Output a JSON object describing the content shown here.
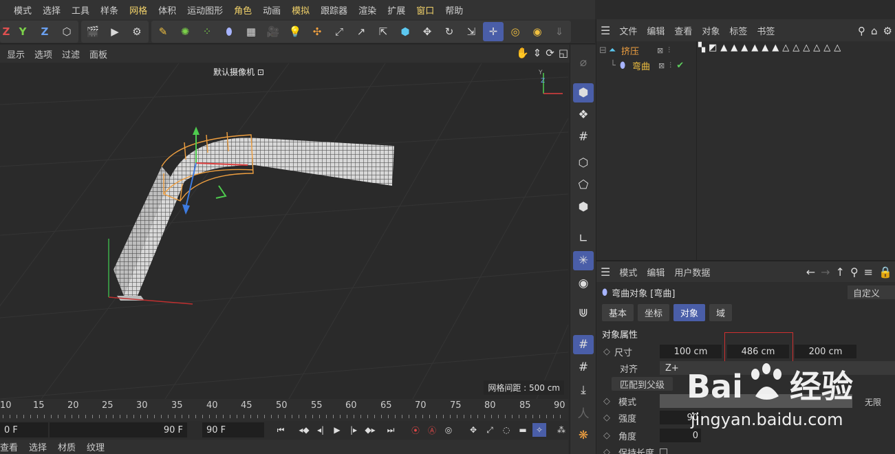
{
  "menu": [
    "模式",
    "选择",
    "工具",
    "样条",
    "网格",
    "体积",
    "运动图形",
    "角色",
    "动画",
    "模拟",
    "跟踪器",
    "渲染",
    "扩展",
    "窗口",
    "帮助"
  ],
  "menu_highlight": [
    "网格",
    "角色",
    "模拟",
    "窗口"
  ],
  "toolbar": {
    "axis_y": "Y",
    "axis_z": "Z",
    "axis_x_partial": "Z"
  },
  "viewport_menu": [
    "显示",
    "选项",
    "过滤",
    "面板"
  ],
  "viewport": {
    "camera_label": "默认摄像机 ⊡",
    "grid_spacing": "网格间距 : 500 cm"
  },
  "timeline": {
    "ticks": [
      "10",
      "15",
      "20",
      "25",
      "30",
      "35",
      "40",
      "45",
      "50",
      "55",
      "60",
      "65",
      "70",
      "75",
      "80",
      "85",
      "90"
    ],
    "start": "0 F",
    "end": "90 F",
    "current": "90 F"
  },
  "material_menu": [
    "查看",
    "选择",
    "材质",
    "纹理"
  ],
  "object_manager": {
    "menu": [
      "文件",
      "编辑",
      "查看",
      "对象",
      "标签",
      "书签"
    ],
    "objects": [
      {
        "name": "挤压",
        "color": "#f0a040"
      },
      {
        "name": "弯曲",
        "color": "#f0c040"
      }
    ]
  },
  "attribute_manager": {
    "menu": [
      "模式",
      "编辑",
      "用户数据"
    ],
    "object_title": "弯曲对象 [弯曲]",
    "custom_label": "自定义",
    "tabs": [
      "基本",
      "坐标",
      "对象",
      "域"
    ],
    "active_tab": "对象",
    "section": "对象属性",
    "size_label": "尺寸",
    "size_values": [
      "100 cm",
      "486 cm",
      "200 cm"
    ],
    "align_label": "对齐",
    "align_value": "Z+",
    "match_parent": "匹配到父级",
    "mode_label": "模式",
    "mode_value": "无限",
    "strength_label": "强度",
    "strength_value": "90",
    "angle_label": "角度",
    "angle_value": "0",
    "keep_length": "保持长度"
  },
  "watermark": {
    "brand": "Baidu",
    "brand_cn": "经验",
    "url": "jingyan.baidu.com"
  }
}
